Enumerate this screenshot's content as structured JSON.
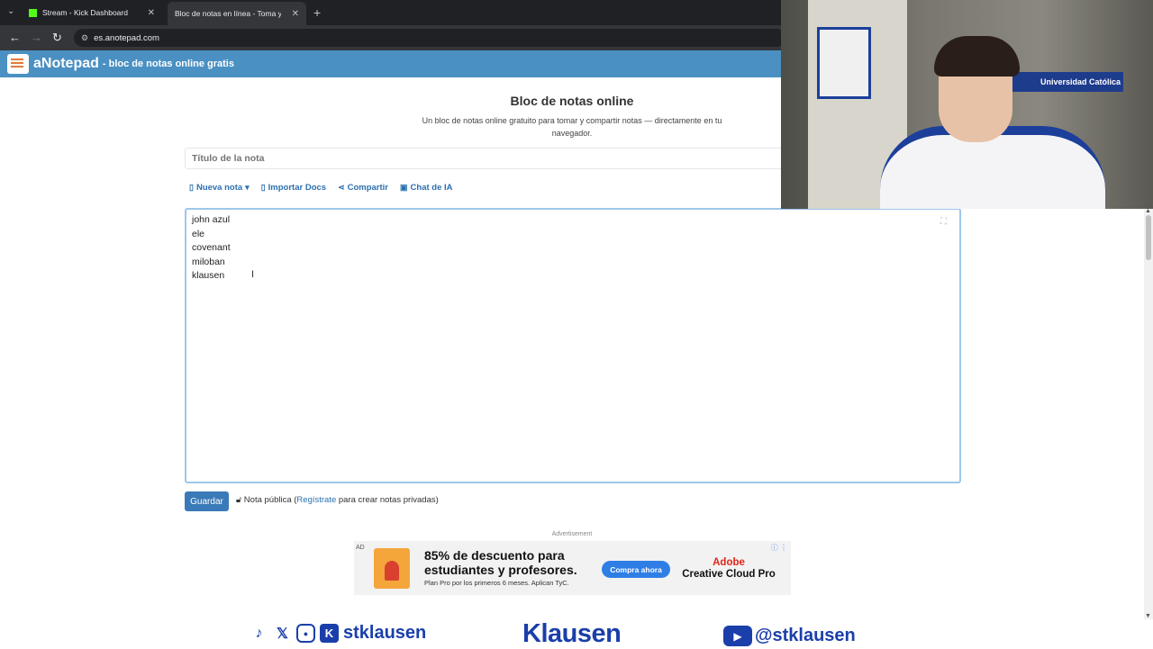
{
  "browser": {
    "tabs": [
      {
        "label": "Stream - Kick Dashboard",
        "active": false
      },
      {
        "label": "Bloc de notas en línea - Toma y",
        "active": true
      }
    ],
    "url": "es.anotepad.com"
  },
  "app": {
    "brand": "aNotepad",
    "tagline": "- bloc de notas online gratis"
  },
  "page": {
    "title": "Bloc de notas online",
    "subtitle": "Un bloc de notas online gratuito para tomar y compartir notas — directamente en tu navegador."
  },
  "note": {
    "title_placeholder": "Título de la nota",
    "menu": {
      "new_note": "Nueva nota",
      "import_docs": "Importar Docs",
      "share": "Compartir",
      "ai_chat": "Chat de IA"
    },
    "lines": [
      "john azul",
      "ele",
      "covenant",
      "miloban",
      "klausen"
    ],
    "save_label": "Guardar",
    "public_note": "Nota pública (",
    "register_link": "Regístrate",
    "public_note_suffix": " para crear notas privadas)"
  },
  "ad": {
    "label": "Advertisement",
    "tag": "AD",
    "headline": "85% de descuento para estudiantes y profesores.",
    "small": "Plan Pro por los primeros 6 meses. Aplican TyC.",
    "cta": "Compra ahora",
    "brand_top": "Adobe",
    "brand_bottom": "Creative Cloud Pro"
  },
  "webcam": {
    "flag_text": "Universidad Católica"
  },
  "overlay": {
    "left_handle": "stklausen",
    "center": "Klausen",
    "right_handle": "@stklausen"
  },
  "colors": {
    "appbar": "#4a90c2",
    "link": "#2c6fb0",
    "overlay": "#1a3faa"
  }
}
